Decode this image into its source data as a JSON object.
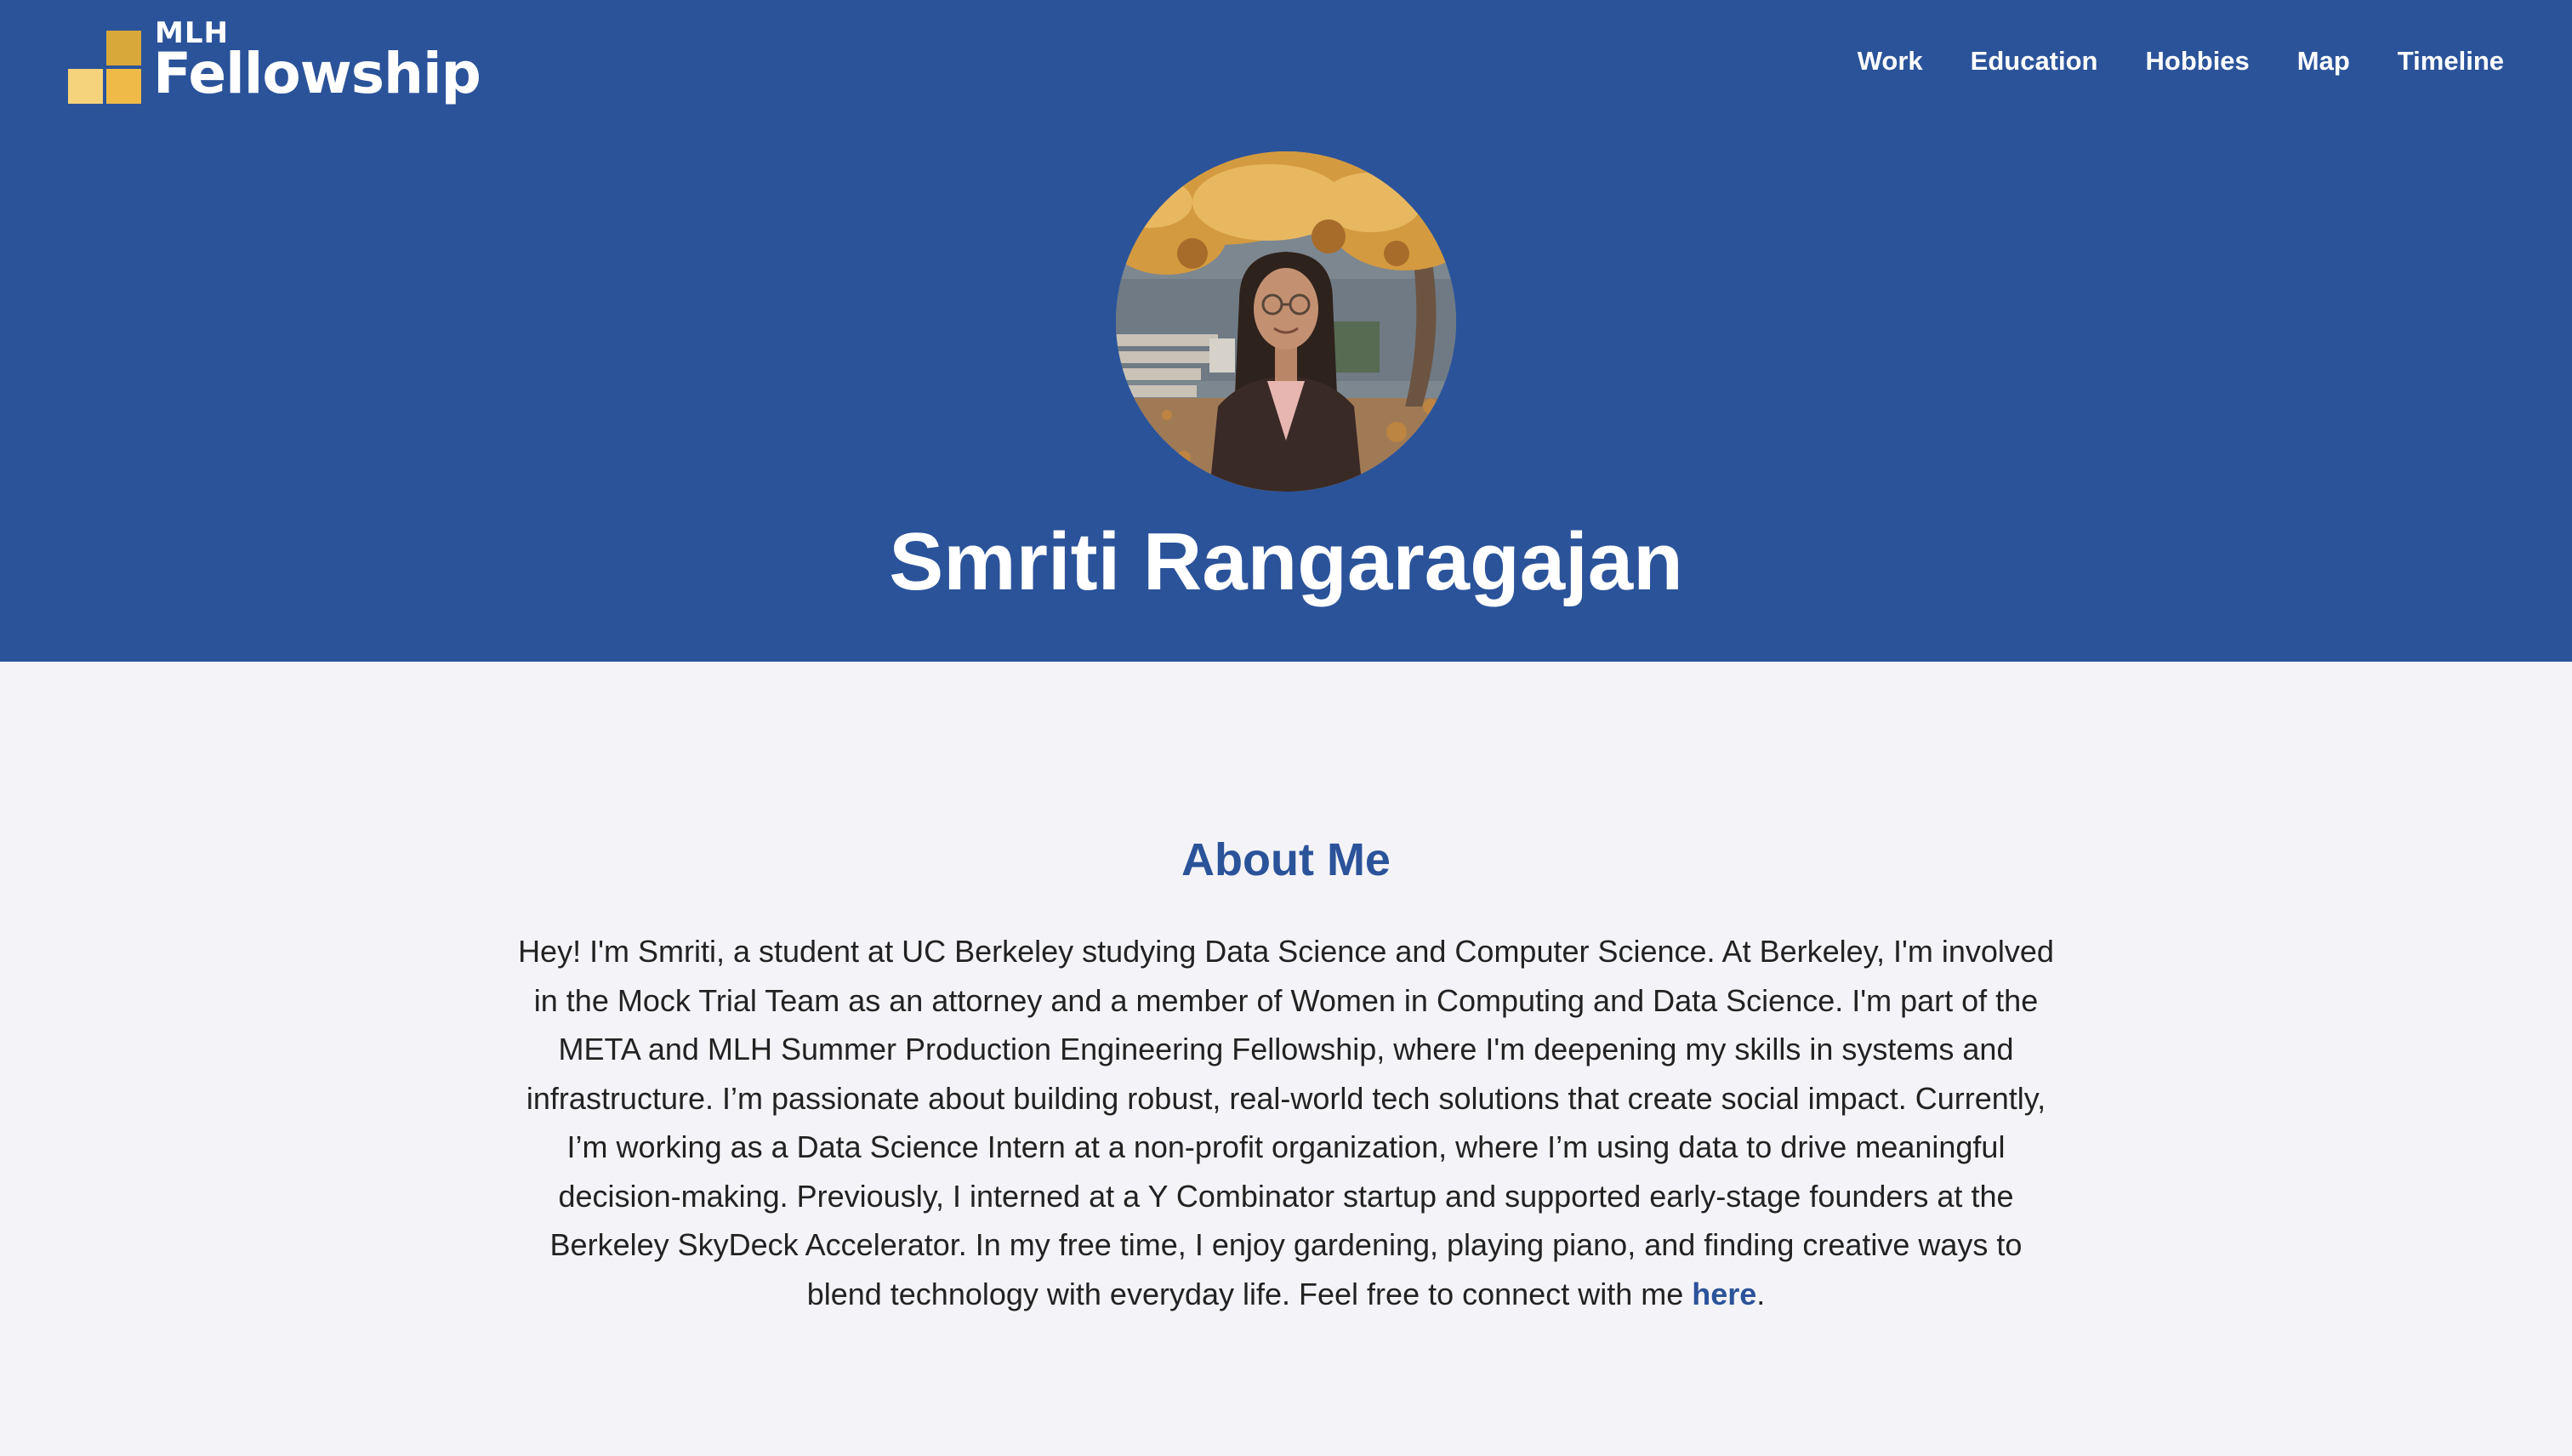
{
  "header": {
    "logo": {
      "small_text": "MLH",
      "big_text": "Fellowship"
    },
    "nav": [
      {
        "label": "Work"
      },
      {
        "label": "Education"
      },
      {
        "label": "Hobbies"
      },
      {
        "label": "Map"
      },
      {
        "label": "Timeline"
      }
    ]
  },
  "profile": {
    "name": "Smriti Rangaragajan"
  },
  "about": {
    "title": "About Me",
    "text_before_link": "Hey! I'm Smriti, a student at UC Berkeley studying Data Science and Computer Science. At Berkeley, I'm involved in the Mock Trial Team as an attorney and a member of Women in Computing and Data Science. I'm part of the META and MLH Summer Production Engineering Fellowship, where I'm deepening my skills in systems and infrastructure. I’m passionate about building robust, real-world tech solutions that create social impact. Currently, I’m working as a Data Science Intern at a non-profit organization, where I’m using data to drive meaningful decision-making. Previously, I interned at a Y Combinator startup and supported early-stage founders at the Berkeley SkyDeck Accelerator. In my free time, I enjoy gardening, playing piano, and finding creative ways to blend technology with everyday life. Feel free to connect with me ",
    "link_text": "here",
    "text_after_link": "."
  },
  "colors": {
    "hero_background": "#2b539a",
    "page_background": "#f4f4f8",
    "accent": "#2b539a",
    "logo_gold": "#efba47"
  }
}
